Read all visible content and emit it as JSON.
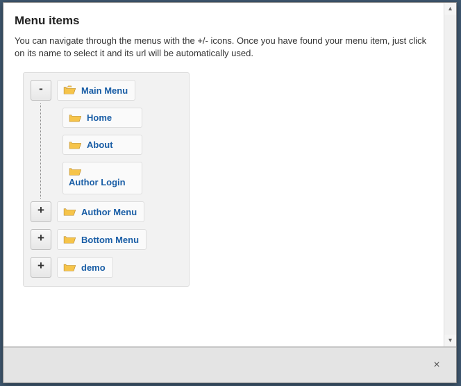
{
  "header": {
    "title": "Menu items"
  },
  "instructions": "You can navigate through the menus with the +/- icons. Once you have found your menu item, just click on its name to select it and its url will be automatically used.",
  "toggle": {
    "expand": "+",
    "collapse": "-"
  },
  "footer": {
    "close_label": "×"
  },
  "tree": {
    "items": [
      {
        "label": "Main Menu",
        "expanded": true,
        "children": [
          {
            "label": "Home"
          },
          {
            "label": "About"
          },
          {
            "label": "Author Login"
          }
        ]
      },
      {
        "label": "Author Menu",
        "expanded": false
      },
      {
        "label": "Bottom Menu",
        "expanded": false
      },
      {
        "label": "demo",
        "expanded": false
      }
    ]
  }
}
